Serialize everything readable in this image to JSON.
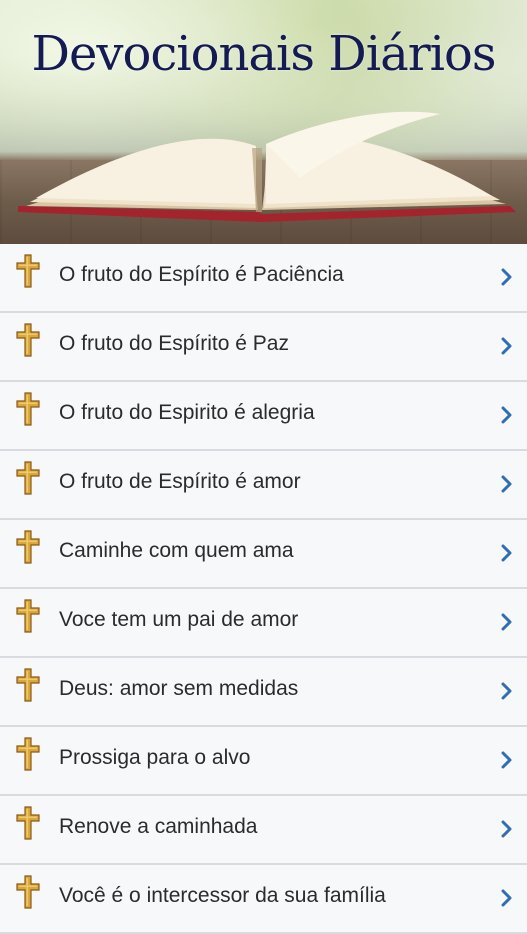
{
  "header": {
    "title": "Devocionais Diários"
  },
  "list": {
    "items": [
      {
        "label": "O fruto do Espírito é Paciência"
      },
      {
        "label": "O fruto do Espírito é Paz"
      },
      {
        "label": "O fruto do Espirito é alegria"
      },
      {
        "label": "O fruto de Espírito é amor"
      },
      {
        "label": "Caminhe com quem ama"
      },
      {
        "label": "Voce tem um pai de amor"
      },
      {
        "label": "Deus: amor sem medidas"
      },
      {
        "label": "Prossiga para o alvo"
      },
      {
        "label": "Renove a caminhada"
      },
      {
        "label": "Você é o intercessor da sua família"
      }
    ]
  },
  "icons": {
    "item_icon": "cross-icon",
    "item_arrow": "chevron-right-icon"
  },
  "colors": {
    "title": "#141a52",
    "cross_gold": "#d9a73a",
    "chevron": "#2f6db5",
    "divider": "#d8dbe0"
  }
}
